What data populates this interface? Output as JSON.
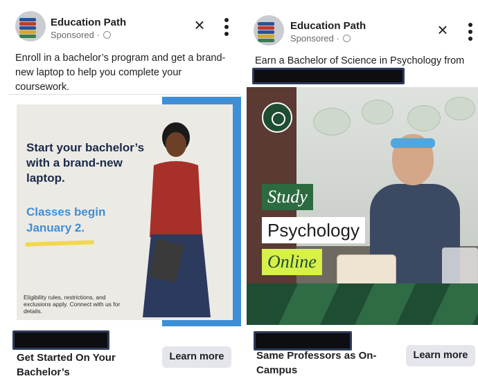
{
  "ads": [
    {
      "page_name": "Education Path",
      "sponsored": "Sponsored ·",
      "body": "Enroll in a bachelor’s program and get a brand-new laptop to help you complete your coursework.",
      "creative": {
        "headline": "Start your bachelor’s with a brand-new laptop.",
        "subheadline": "Classes begin January 2.",
        "fine_print": "Eligibility rules, restrictions, and exclusions apply. Connect with us for details."
      },
      "cta_title": "Get Started On Your Bachelor’s",
      "cta_button": "Learn more"
    },
    {
      "page_name": "Education Path",
      "sponsored": "Sponsored ·",
      "body": "Earn a Bachelor of Science in Psychology from",
      "creative": {
        "tag1": "Study",
        "tag2": "Psychology",
        "tag3": "Online"
      },
      "cta_title": "Same Professors as On-Campus",
      "cta_button": "Learn more"
    }
  ],
  "icons": {
    "close": "close-icon",
    "more": "more-options-icon",
    "globe": "globe-icon",
    "avatar": "books-avatar"
  },
  "colors": {
    "accent_blue": "#3e8fd6",
    "navy": "#1b2a4a",
    "green": "#2c6b40",
    "lime": "#d7f04a"
  }
}
